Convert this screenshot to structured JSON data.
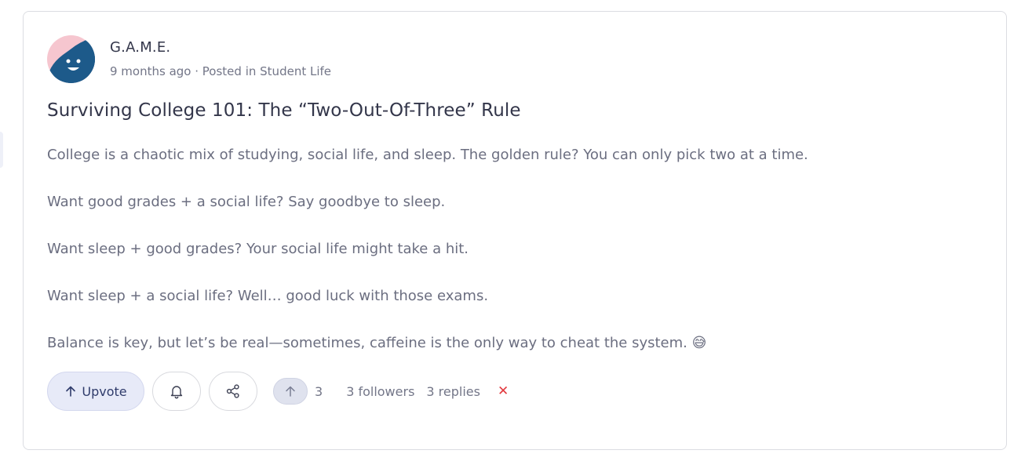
{
  "post": {
    "author": "G.A.M.E.",
    "time_ago": "9 months ago",
    "separator": " · ",
    "posted_in_prefix": "Posted in ",
    "category": "Student Life",
    "title": "Surviving College 101: The “Two-Out-Of-Three” Rule",
    "paragraphs": [
      "College is a chaotic mix of studying, social life, and sleep. The golden rule? You can only pick two at a time.",
      "Want good grades + a social life? Say goodbye to sleep.",
      "Want sleep + good grades? Your social life might take a hit.",
      "Want sleep + a social life? Well… good luck with those exams.",
      "Balance is key, but let’s be real—sometimes, caffeine is the only way to cheat the system. 😅"
    ]
  },
  "actions": {
    "upvote_label": "Upvote",
    "vote_count": "3",
    "followers": "3 followers",
    "replies": "3 replies",
    "dismiss_symbol": "✕"
  },
  "icons": {
    "upvote": "arrow-up-icon",
    "follow": "bell-icon",
    "share": "share-icon",
    "vote_badge": "arrow-up-icon"
  },
  "colors": {
    "accent_blue": "#1d5a8a",
    "avatar_pink": "#f6c6cf",
    "dismiss_red": "#e2393e"
  }
}
